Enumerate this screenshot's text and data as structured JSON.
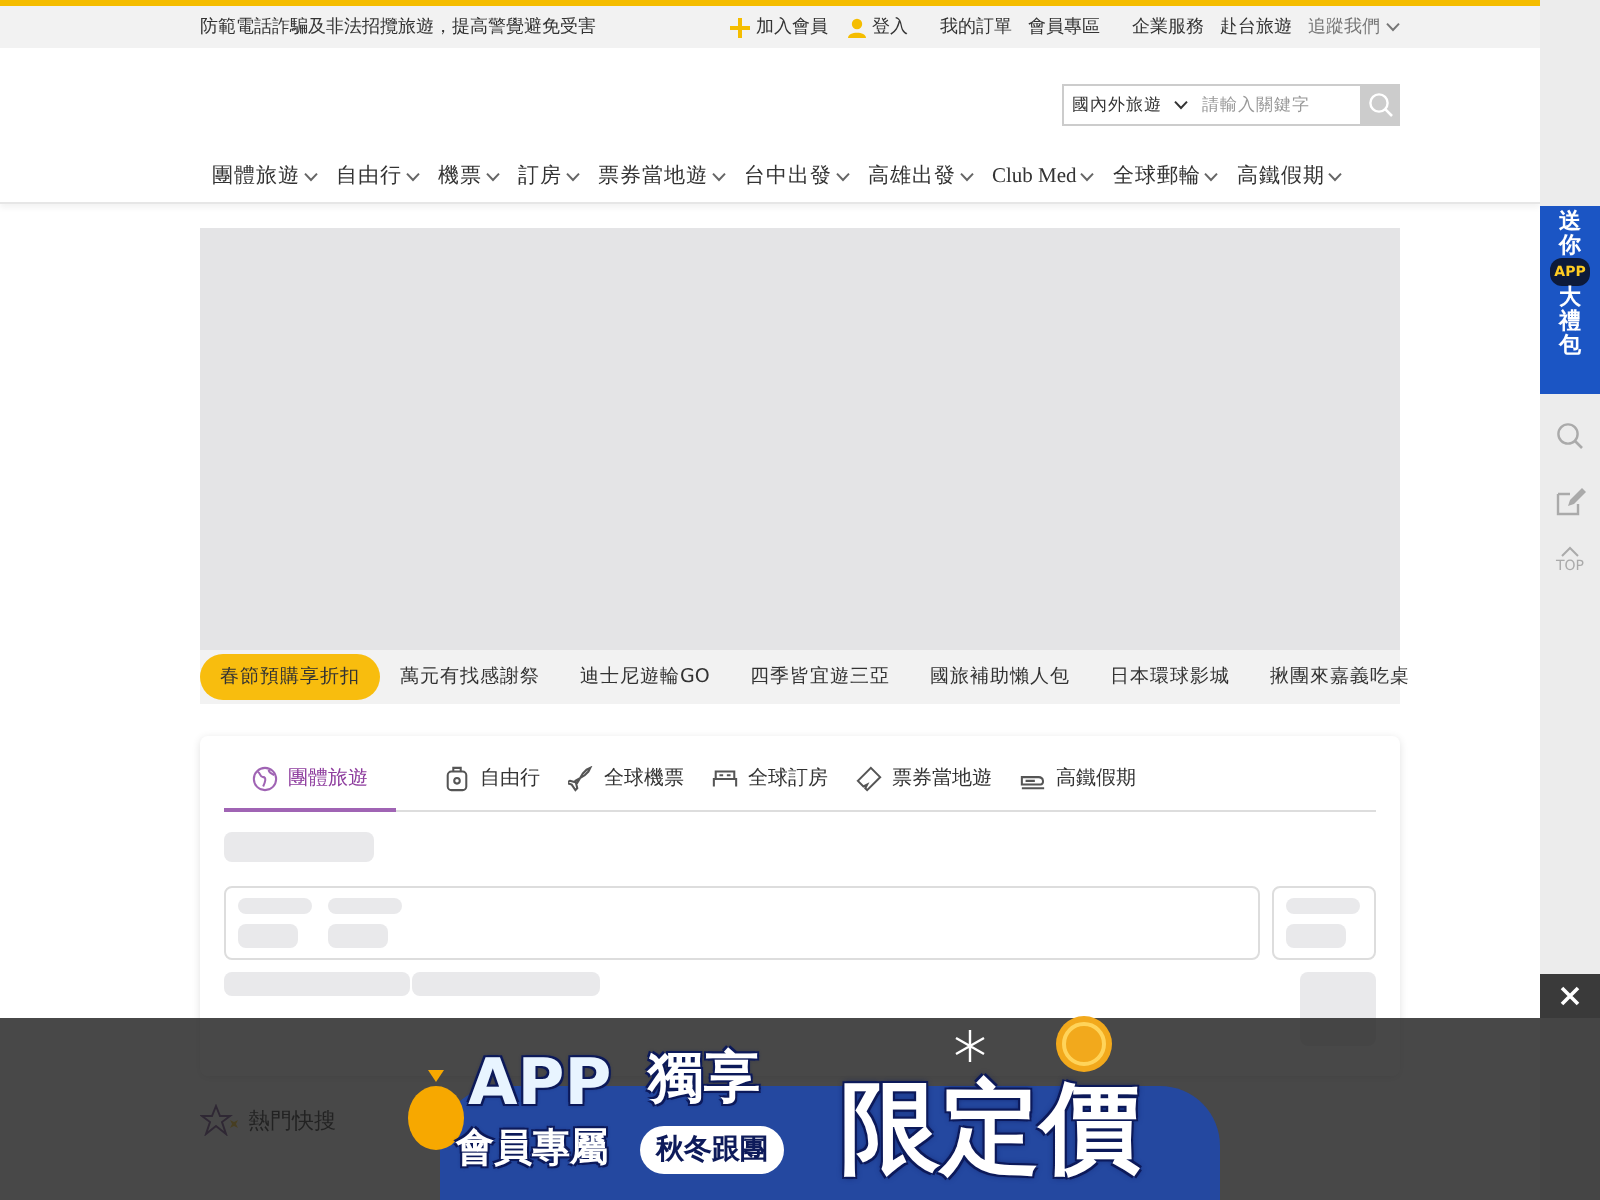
{
  "top_bar": {
    "notice": "防範電話詐騙及非法招攬旅遊，提高警覺避免受害",
    "links": [
      {
        "label": "加入會員",
        "kind": "plus"
      },
      {
        "label": "登入",
        "kind": "user"
      },
      {
        "label": "我的訂單",
        "kind": "text"
      },
      {
        "label": "會員專區",
        "kind": "text"
      },
      {
        "label": "企業服務",
        "kind": "text"
      },
      {
        "label": "赴台旅遊",
        "kind": "text"
      },
      {
        "label": "追蹤我們",
        "kind": "dropdown"
      }
    ]
  },
  "search": {
    "scope": "國內外旅遊",
    "placeholder": "請輸入關鍵字"
  },
  "nav": [
    "團體旅遊",
    "自由行",
    "機票",
    "訂房",
    "票券當地遊",
    "台中出發",
    "高雄出發",
    "Club Med",
    "全球郵輪",
    "高鐵假期"
  ],
  "promo_tabs": [
    {
      "label": "春節預購享折扣",
      "selected": true
    },
    {
      "label": "萬元有找感謝祭",
      "selected": false
    },
    {
      "label": "迪士尼遊輪GO",
      "selected": false
    },
    {
      "label": "四季皆宜遊三亞",
      "selected": false
    },
    {
      "label": "國旅補助懶人包",
      "selected": false
    },
    {
      "label": "日本環球影城",
      "selected": false
    },
    {
      "label": "揪團來嘉義吃桌",
      "selected": false
    }
  ],
  "search_tabs": [
    {
      "label": "團體旅遊",
      "kind": "globe",
      "selected": true
    },
    {
      "label": "自由行",
      "kind": "luggage",
      "selected": false
    },
    {
      "label": "全球機票",
      "kind": "plane",
      "selected": false
    },
    {
      "label": "全球訂房",
      "kind": "bed",
      "selected": false
    },
    {
      "label": "票券當地遊",
      "kind": "ticket",
      "selected": false
    },
    {
      "label": "高鐵假期",
      "kind": "train",
      "selected": false
    }
  ],
  "hot_search": {
    "title": "熱門快搜"
  },
  "side_rail": {
    "promo": [
      "送",
      "你",
      "APP",
      "大",
      "禮",
      "包"
    ],
    "top": "TOP"
  },
  "app_banner": {
    "app": "APP",
    "exclusive": "獨享",
    "members": "會員專屬",
    "tour": "秋冬跟團",
    "price": "限定價"
  }
}
